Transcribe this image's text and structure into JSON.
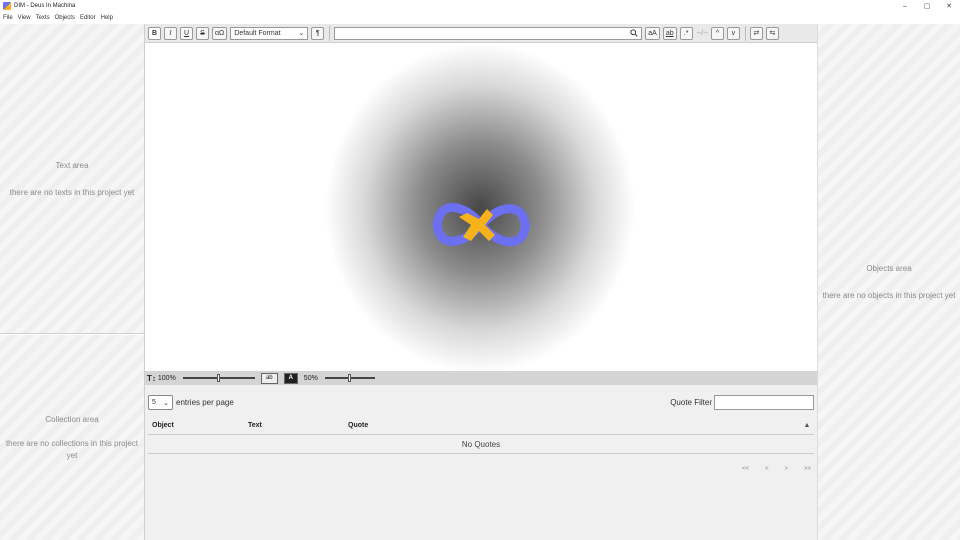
{
  "window": {
    "title": "DIM - Deus In Machina",
    "controls": {
      "minimize": "–",
      "maximize": "▢",
      "close": "✕"
    }
  },
  "menu": [
    "File",
    "View",
    "Texts",
    "Objects",
    "Editor",
    "Help"
  ],
  "text_area": {
    "title": "Text area",
    "empty": "there are no texts in this project yet"
  },
  "collection_area": {
    "title": "Collection area",
    "empty": "there are no collections in this project yet"
  },
  "objects_area": {
    "title": "Objects area",
    "empty": "there are no objects in this project yet"
  },
  "toolbar": {
    "bold": "B",
    "italic": "I",
    "underline": "U",
    "strike": "S",
    "special_chars": "αΩ",
    "format_select": "Default Format",
    "pilcrow": "¶",
    "search_value": "",
    "match_case": "aA",
    "whole_word": "ab",
    "regex": ".*",
    "match_count": "--/--",
    "prev": "^",
    "next": "v",
    "replace": "⇄",
    "replace_all": "⇆"
  },
  "zoombar": {
    "icon": "T↕",
    "font_zoom": "100%",
    "font_zoom_value": 0.5,
    "spell_icon": "ab",
    "highlight_icon": "A",
    "opacity": "50%",
    "opacity_value": 0.5
  },
  "quotes": {
    "entries_value": "5",
    "entries_label": "entries per page",
    "filter_label": "Quote Filter",
    "filter_value": "",
    "columns": [
      "Object",
      "Text",
      "Quote"
    ],
    "sort_icon": "▲",
    "empty": "No Quotes",
    "pager": [
      "<<",
      "<",
      ">",
      ">>"
    ]
  },
  "colors": {
    "logo_blue": "#6b6ff0",
    "logo_yellow": "#f5b21a"
  }
}
